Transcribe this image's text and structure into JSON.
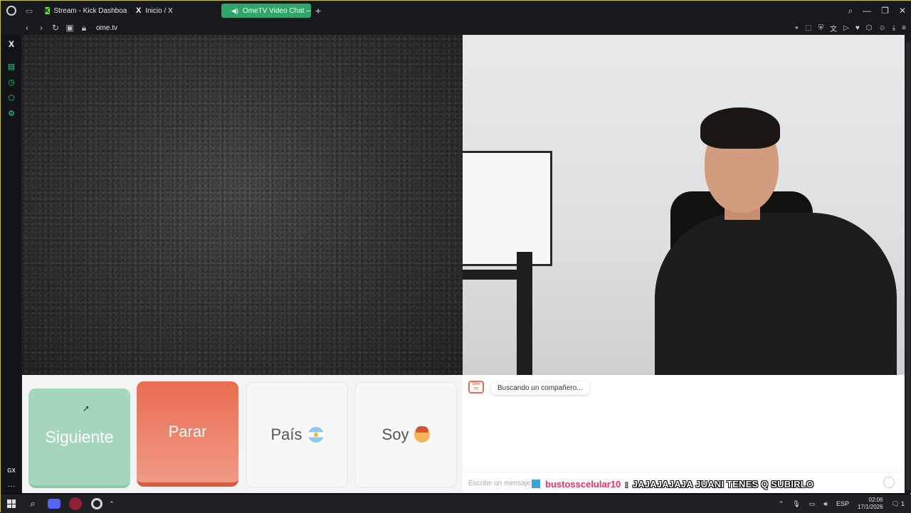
{
  "browser": {
    "tabs": [
      {
        "label": "Stream - Kick Dashboard",
        "favicon": "kick-icon"
      },
      {
        "label": "Inicio / X",
        "favicon": "x-icon"
      },
      {
        "label": "OmeTV Video Chat —",
        "favicon": "ometv-icon",
        "active": true
      }
    ],
    "url": "ome.tv"
  },
  "controls": {
    "next_label": "Siguiente",
    "stop_label": "Parar",
    "country_label": "País",
    "gender_label": "Soy"
  },
  "chat": {
    "status_message": "Buscando un compañero...",
    "input_placeholder": "Escribe un mensaje"
  },
  "stream_overlay": {
    "username": "bustosscelular10",
    "separator": ":",
    "message": "JAJAJAJAJA JUANI TENES Q SUBIRLO"
  },
  "taskbar": {
    "language": "ESP",
    "time": "02:06",
    "date": "17/1/2026",
    "notification_count": "1"
  },
  "colors": {
    "next_button": "#a4d7bc",
    "stop_button": "#ea6d52",
    "active_tab": "#2fa46b",
    "overlay_username": "#ff2a5a"
  }
}
